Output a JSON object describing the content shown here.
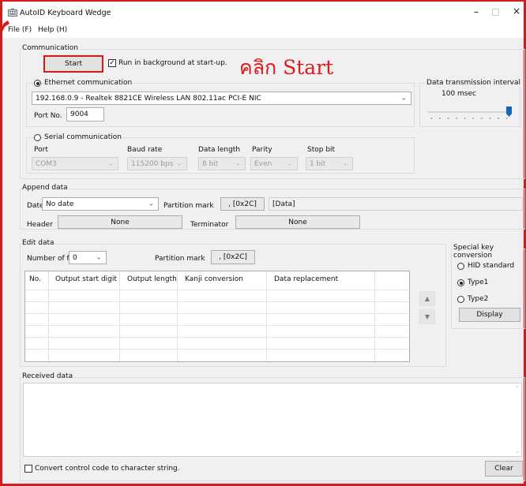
{
  "window": {
    "title": "AutoID Keyboard Wedge"
  },
  "menu": {
    "file": "File (F)",
    "help": "Help (H)"
  },
  "communication": {
    "title": "Communication",
    "start_button": "Start",
    "run_background": "Run in background at start-up.",
    "annotation": "คลิก Start",
    "ethernet": {
      "label": "Ethernet communication",
      "adapter": "192.168.0.9 - Realtek 8821CE Wireless LAN 802.11ac PCI-E NIC",
      "port_label": "Port No.",
      "port_value": "9004"
    },
    "interval": {
      "title": "Data transmission interval",
      "value": "100 msec"
    },
    "serial": {
      "label": "Serial communication",
      "port_label": "Port",
      "port_value": "COM3",
      "baud_label": "Baud rate",
      "baud_value": "115200 bps",
      "length_label": "Data length",
      "length_value": "8 bit",
      "parity_label": "Parity",
      "parity_value": "Even",
      "stop_label": "Stop bit",
      "stop_value": "1 bit"
    }
  },
  "append": {
    "title": "Append data",
    "date_label": "Date",
    "date_value": "No date",
    "partition_label": "Partition mark",
    "partition_value": ", [0x2C]",
    "data_value": "[Data]",
    "header_label": "Header",
    "header_value": "None",
    "terminator_label": "Terminator",
    "terminator_value": "None"
  },
  "edit": {
    "title": "Edit data",
    "fields_label": "Number of fields",
    "fields_value": "0",
    "partition_label": "Partition mark",
    "partition_value": ", [0x2C]",
    "columns": [
      "No.",
      "Output start digit",
      "Output length",
      "Kanji conversion",
      "Data replacement"
    ]
  },
  "special": {
    "title": "Special key conversion",
    "hid": "HID standard",
    "type1": "Type1",
    "type2": "Type2",
    "display": "Display"
  },
  "received": {
    "title": "Received data",
    "convert": "Convert control code to character string.",
    "clear": "Clear"
  },
  "colors": {
    "annotation": "#e0191f",
    "slider": "#1565c0",
    "border_highlight": "#d41a1a"
  }
}
